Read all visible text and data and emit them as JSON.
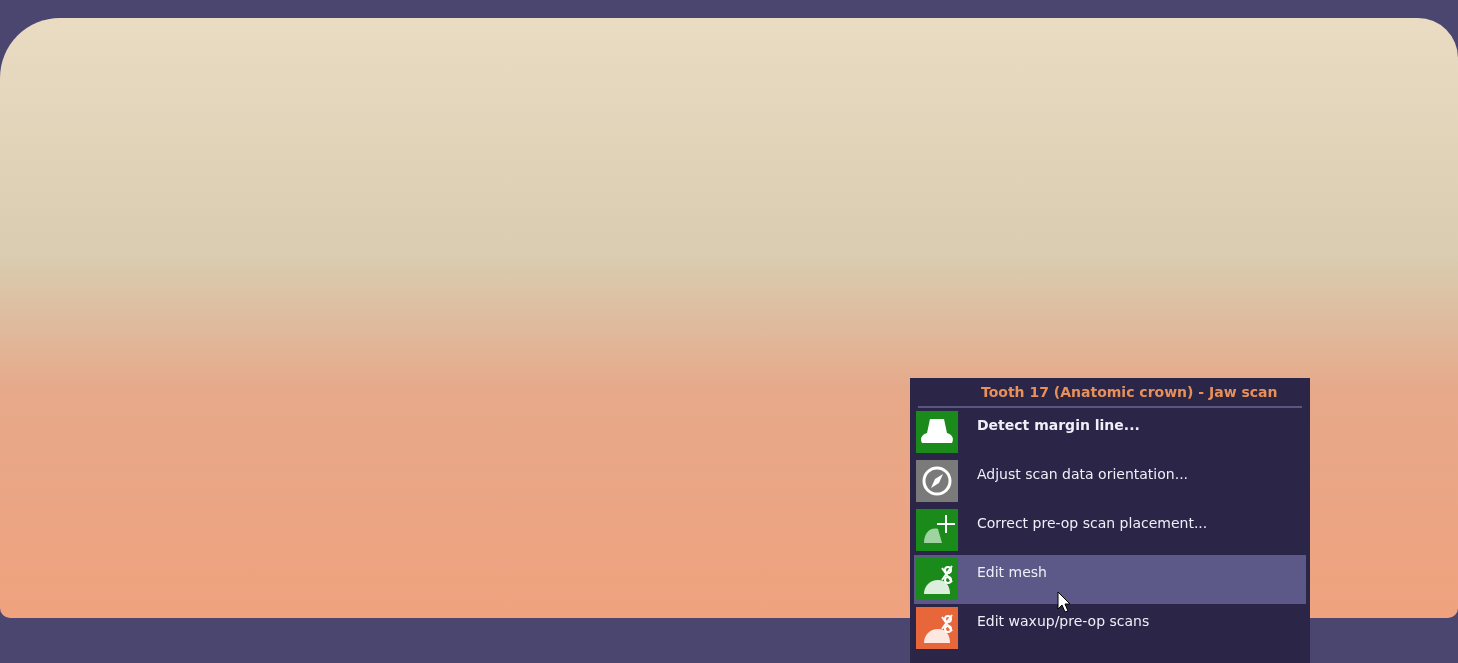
{
  "context_menu": {
    "title": "Tooth 17 (Anatomic crown) - Jaw scan",
    "items": [
      {
        "label": "Detect margin line...",
        "bold": true,
        "selected": false,
        "color": "#1a8a1a",
        "kind": "crown"
      },
      {
        "label": "Adjust scan data orientation...",
        "bold": false,
        "selected": false,
        "color": "#7a7a7a",
        "kind": "compass"
      },
      {
        "label": "Correct pre-op scan placement...",
        "bold": false,
        "selected": false,
        "color": "#1a8a1a",
        "kind": "move"
      },
      {
        "label": "Edit mesh",
        "bold": false,
        "selected": true,
        "color": "#1a8a1a",
        "kind": "scissors"
      },
      {
        "label": "Edit waxup/pre-op scans",
        "bold": false,
        "selected": false,
        "color": "#e8673a",
        "kind": "scissors"
      }
    ]
  }
}
